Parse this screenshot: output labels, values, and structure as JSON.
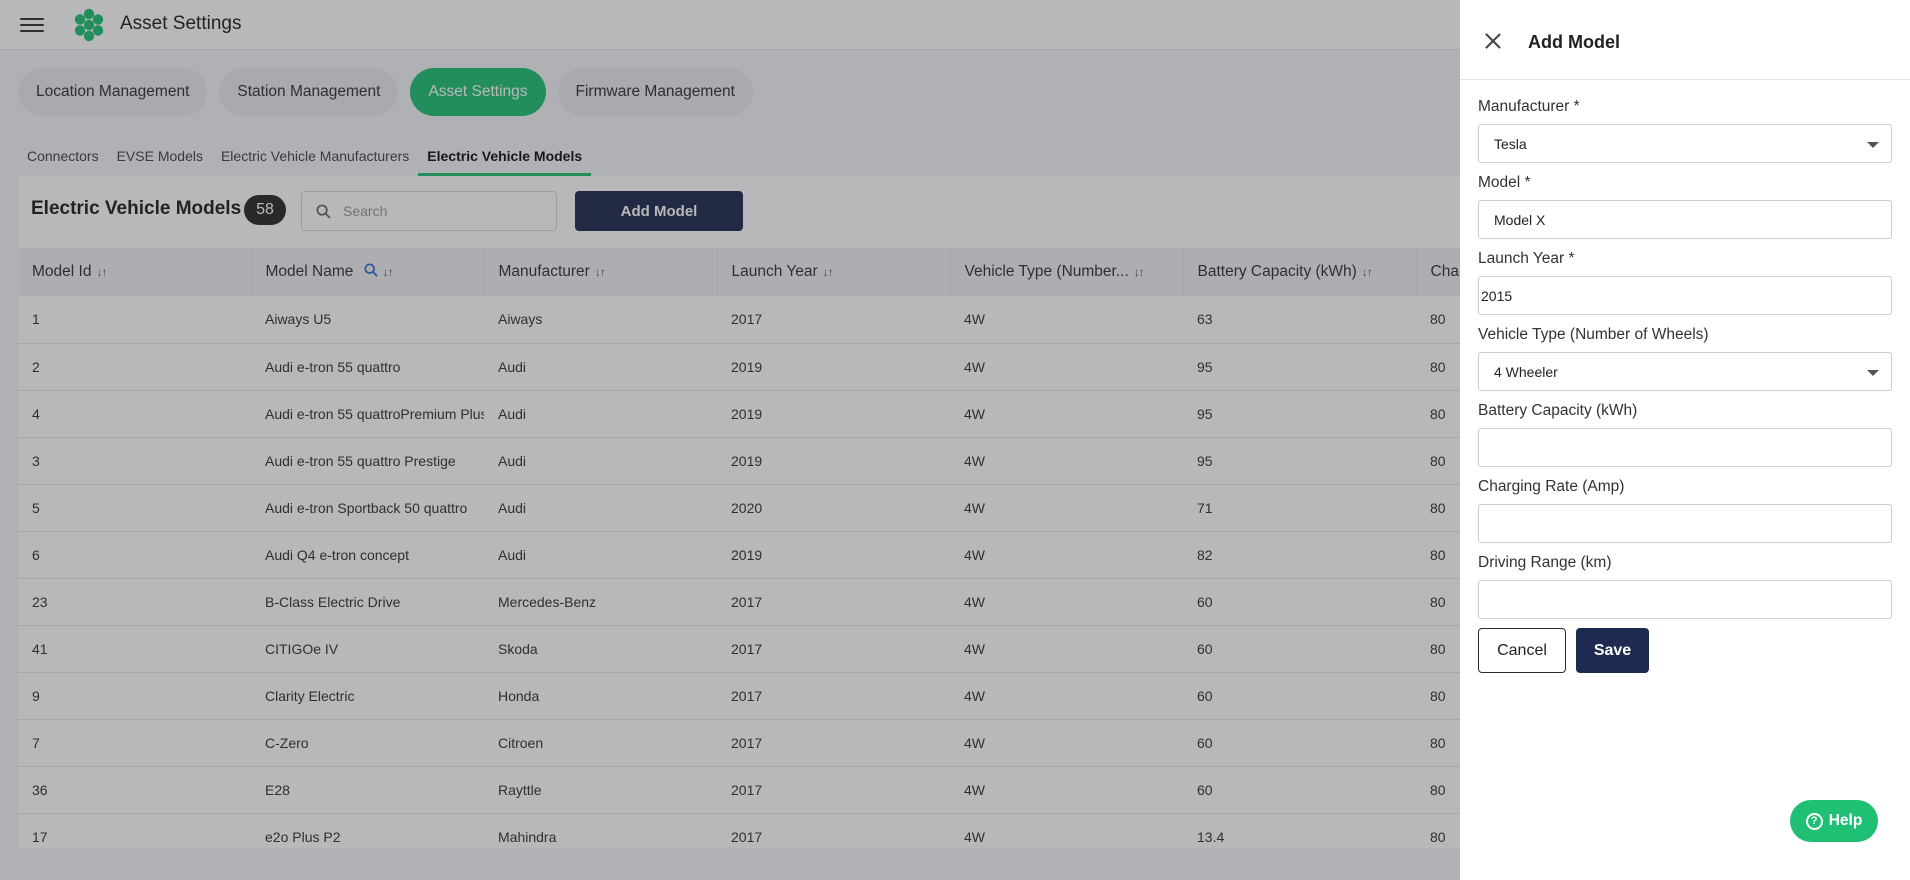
{
  "header": {
    "title": "Asset Settings"
  },
  "main_tabs": [
    {
      "label": "Location Management"
    },
    {
      "label": "Station Management"
    },
    {
      "label": "Asset Settings"
    },
    {
      "label": "Firmware Management"
    }
  ],
  "sub_tabs": [
    {
      "label": "Connectors"
    },
    {
      "label": "EVSE Models"
    },
    {
      "label": "Electric Vehicle Manufacturers"
    },
    {
      "label": "Electric Vehicle Models"
    }
  ],
  "list": {
    "title": "Electric Vehicle Models",
    "count": "58",
    "search_placeholder": "Search",
    "add_label": "Add Model"
  },
  "table": {
    "columns": [
      "Model Id",
      "Model Name",
      "Manufacturer",
      "Launch Year",
      "Vehicle Type (Number...",
      "Battery Capacity (kWh)",
      "Cha"
    ],
    "rows": [
      [
        "1",
        "Aiways U5",
        "Aiways",
        "2017",
        "4W",
        "63",
        "80"
      ],
      [
        "2",
        "Audi e-tron 55 quattro",
        "Audi",
        "2019",
        "4W",
        "95",
        "80"
      ],
      [
        "4",
        "Audi e-tron 55 quattroPremium Plus",
        "Audi",
        "2019",
        "4W",
        "95",
        "80"
      ],
      [
        "3",
        "Audi e-tron 55 quattro Prestige",
        "Audi",
        "2019",
        "4W",
        "95",
        "80"
      ],
      [
        "5",
        "Audi e-tron Sportback 50 quattro",
        "Audi",
        "2020",
        "4W",
        "71",
        "80"
      ],
      [
        "6",
        "Audi Q4 e-tron concept",
        "Audi",
        "2019",
        "4W",
        "82",
        "80"
      ],
      [
        "23",
        "B-Class Electric Drive",
        "Mercedes-Benz",
        "2017",
        "4W",
        "60",
        "80"
      ],
      [
        "41",
        "CITIGOe IV",
        "Skoda",
        "2017",
        "4W",
        "60",
        "80"
      ],
      [
        "9",
        "Clarity Electric",
        "Honda",
        "2017",
        "4W",
        "60",
        "80"
      ],
      [
        "7",
        "C-Zero",
        "Citroen",
        "2017",
        "4W",
        "60",
        "80"
      ],
      [
        "36",
        "E28",
        "Rayttle",
        "2017",
        "4W",
        "60",
        "80"
      ],
      [
        "17",
        "e2o Plus P2",
        "Mahindra",
        "2017",
        "4W",
        "13.4",
        "80"
      ]
    ]
  },
  "drawer": {
    "title": "Add Model",
    "fields": {
      "manufacturer": {
        "label": "Manufacturer *",
        "value": "Tesla"
      },
      "model": {
        "label": "Model *",
        "value": "Model X"
      },
      "launch_year": {
        "label": "Launch Year *",
        "value": "2015"
      },
      "vehicle_type": {
        "label": "Vehicle Type (Number of Wheels)",
        "value": "4 Wheeler"
      },
      "battery": {
        "label": "Battery Capacity (kWh)",
        "value": ""
      },
      "charging_rate": {
        "label": "Charging Rate (Amp)",
        "value": ""
      },
      "driving_range": {
        "label": "Driving Range (km)",
        "value": ""
      }
    },
    "cancel_label": "Cancel",
    "save_label": "Save"
  },
  "help": {
    "label": "Help"
  },
  "colors": {
    "accent": "#1fc073",
    "primary": "#1e2a4f"
  }
}
